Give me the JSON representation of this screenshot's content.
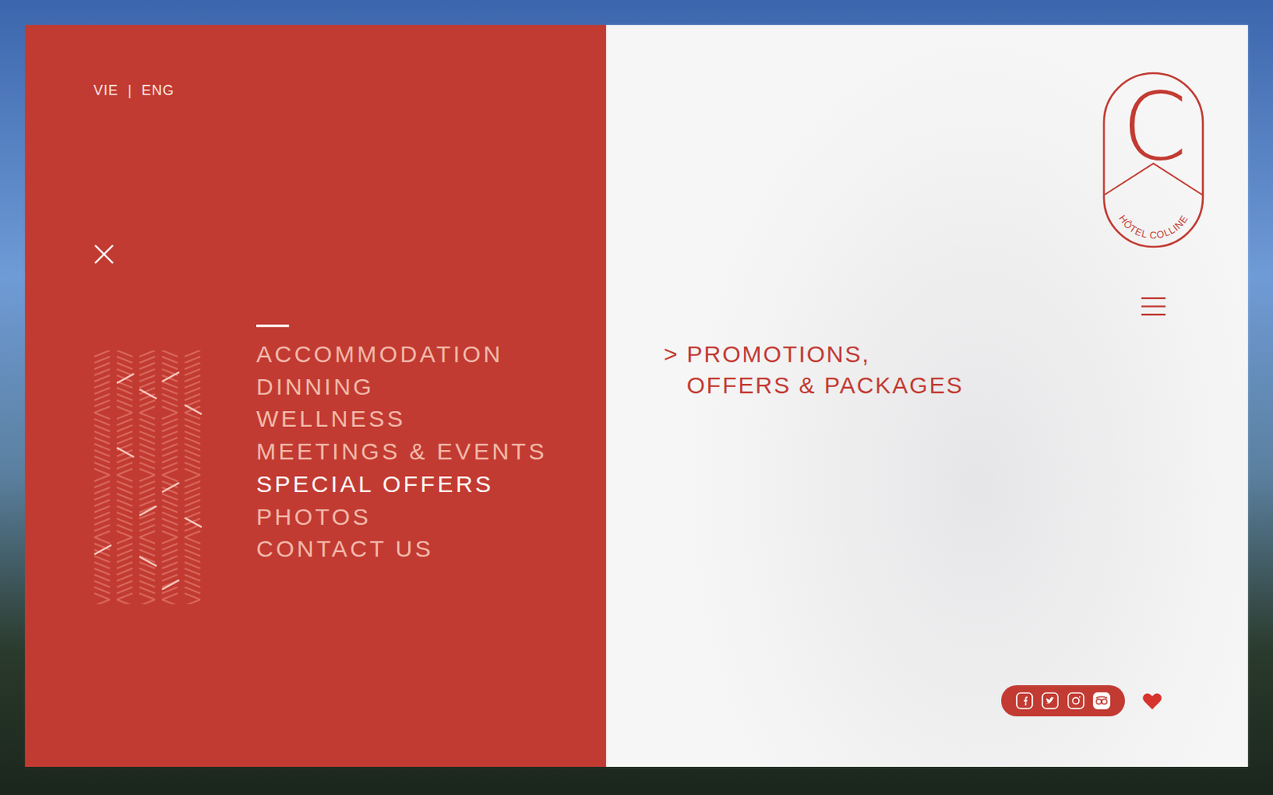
{
  "language_switch": {
    "options": [
      {
        "label": "VIE"
      },
      {
        "label": "ENG"
      }
    ],
    "separator": "|"
  },
  "menu": {
    "items": [
      {
        "label": "ACCOMMODATION",
        "selected": false
      },
      {
        "label": "DINNING",
        "selected": false
      },
      {
        "label": "WELLNESS",
        "selected": false
      },
      {
        "label": "MEETINGS & EVENTS",
        "selected": false
      },
      {
        "label": "SPECIAL OFFERS",
        "selected": true
      },
      {
        "label": "PHOTOS",
        "selected": false
      },
      {
        "label": "CONTACT US",
        "selected": false
      }
    ]
  },
  "content": {
    "arrow": ">",
    "title_lines": [
      "PROMOTIONS,",
      "OFFERS & PACKAGES"
    ]
  },
  "logo": {
    "mark": "C",
    "name": "HÔTEL COLLINE"
  }
}
